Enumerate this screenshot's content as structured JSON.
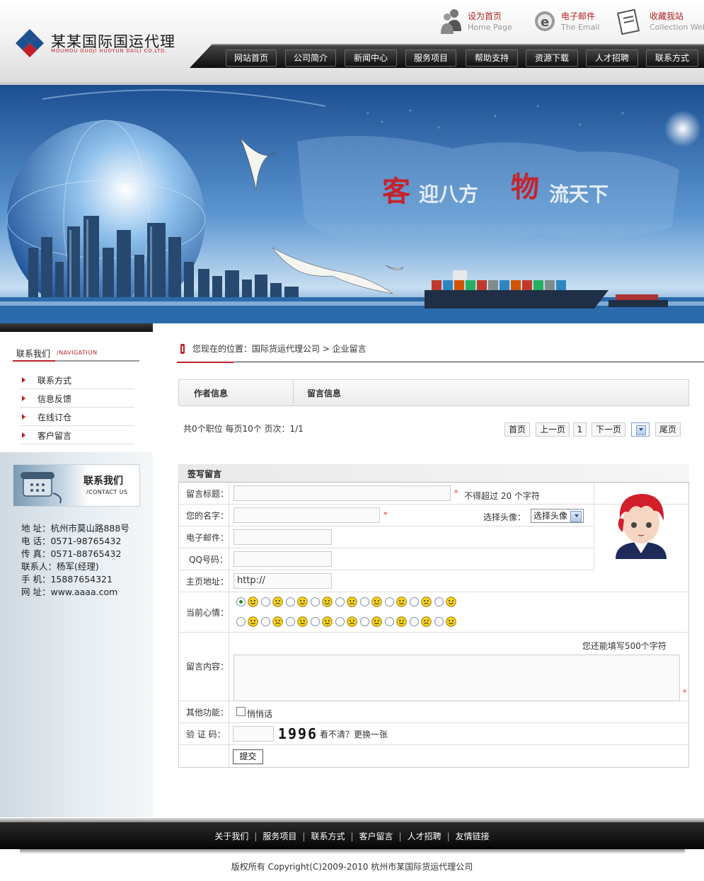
{
  "header": {
    "logo_cn": "某某国际国运代理",
    "logo_en": "MOUMOU GUOJI HUOYUN DAILI CO.LTD.",
    "quick_links": [
      {
        "cn": "设为首页",
        "en": "Home Page",
        "icon": "home-person-icon"
      },
      {
        "cn": "电子邮件",
        "en": "The Email",
        "icon": "email-icon"
      },
      {
        "cn": "收藏我站",
        "en": "Collection Web",
        "icon": "bookmark-icon"
      }
    ],
    "nav": [
      "网站首页",
      "公司简介",
      "新闻中心",
      "服务项目",
      "帮助支持",
      "资源下载",
      "人才招聘",
      "联系方式"
    ]
  },
  "banner": {
    "slogan_1a": "客",
    "slogan_1b": "迎八方",
    "slogan_2a": "物",
    "slogan_2b": "流天下"
  },
  "sidebar": {
    "title": "联系我们",
    "title_en": "/NAVIGATION",
    "items": [
      "联系方式",
      "信息反馈",
      "在线订仓",
      "客户留言"
    ],
    "contact_title": "联系我们",
    "contact_title_en": "/CONTACT US",
    "contact_info": [
      "地 址：杭州市莫山路888号",
      "电 话：0571-98765432",
      "传 真：0571-88765432",
      "联系人：杨军(经理)",
      "手 机：15887654321",
      "网 址：www.aaaa.com"
    ]
  },
  "main": {
    "breadcrumb": "您现在的位置：国际货运代理公司  > 企业留言",
    "msg_head_author": "作者信息",
    "msg_head_message": "留言信息",
    "pager_info": "共0个职位  每页10个  页次：1/1",
    "pager": {
      "first": "首页",
      "prev": "上一页",
      "current": "1",
      "next": "下一页",
      "last": "尾页"
    },
    "form": {
      "title": "签写留言",
      "label_subject": "留言标题：",
      "subject_note": "不得超过  20 个字符",
      "label_name": "您的名字：",
      "label_avatar": "选择头像：",
      "avatar_select": "选择头像",
      "label_email": "电子邮件：",
      "label_qq": "QQ号码：",
      "label_homepage": "主页地址：",
      "homepage_value": "http://",
      "label_mood": "当前心情：",
      "label_content": "留言内容：",
      "content_counter": "您还能填写500个字符",
      "label_other": "其他功能：",
      "whisper": "悄悄话",
      "label_captcha": "验 证 码：",
      "captcha_code": "1996",
      "captcha_refresh": "看不清？更换一张",
      "submit": "提交",
      "star": "*"
    }
  },
  "footer": {
    "links": [
      "关于我们",
      "服务项目",
      "联系方式",
      "客户留言",
      "人才招聘",
      "友情链接"
    ],
    "copyright": "版权所有  Copyright(C)2009-2010 杭州市某国际货运代理公司"
  },
  "colors": {
    "accent": "#c0202a",
    "nav_bg": "#111111",
    "banner_sky": "#3f78b8"
  }
}
